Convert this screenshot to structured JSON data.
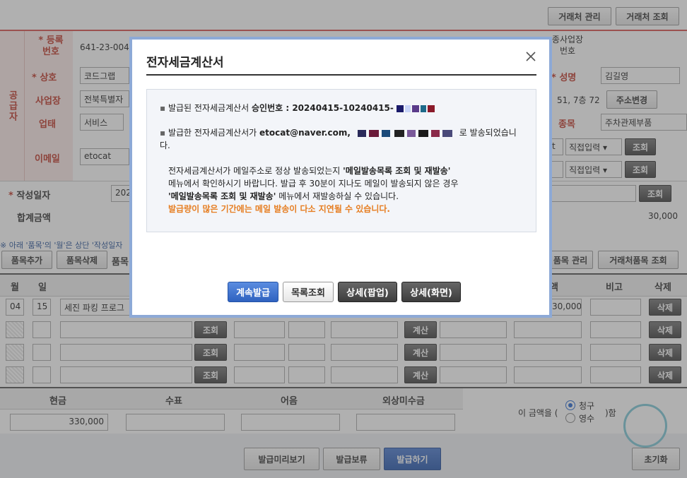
{
  "top_buttons": {
    "vendor_manage": "거래처 관리",
    "vendor_search": "거래처 조회"
  },
  "supplier": {
    "section_label": "공급자",
    "reg_no_label": "등록\n번호",
    "reg_no_value": "641-23-0042",
    "name_label": "상호",
    "name_value": "코드그랩",
    "biz_addr_label": "사업장",
    "biz_addr_value": "전북특별자",
    "biz_type_label": "업태",
    "biz_type_value": "서비스",
    "email_label": "이메일",
    "email_value": "etocat"
  },
  "buyer": {
    "sub_biz_label": "종사업장\n번호",
    "rep_name_label": "성명",
    "rep_name_value": "김길영",
    "addr_value": "51, 7층 72",
    "addr_change_button": "주소변경",
    "item_label": "종목",
    "item_value": "주차관제부품",
    "email_domain_1": "t",
    "email_select_1": "직접입력",
    "email_select_2": "직접입력",
    "lookup_button": "조회"
  },
  "write_date": {
    "label": "작성일자",
    "value": "202"
  },
  "total": {
    "label": "합계금액",
    "value": "30,000"
  },
  "notice": "※ 아래 '품목'의 '월'은 상단 '작성일자",
  "item_buttons": {
    "add": "품목추가",
    "delete": "품목삭제",
    "item_prefix": "품목",
    "item_manage": "품목 관리",
    "vendor_item_search": "거래처품목 조회"
  },
  "table_headers": {
    "month": "월",
    "day": "일",
    "amount_tail": "액",
    "remark": "비고",
    "delete": "삭제"
  },
  "rows": [
    {
      "month": "04",
      "day": "15",
      "item": "세진 파킹 프로그",
      "amount": "30,000"
    }
  ],
  "row_buttons": {
    "lookup": "조회",
    "calc": "계산",
    "delete": "삭제"
  },
  "payment": {
    "cash_label": "현금",
    "check_label": "수표",
    "note_label": "어음",
    "credit_label": "외상미수금",
    "cash_value": "330,000",
    "amount_text_prefix": "이 금액을 (",
    "amount_text_suffix": ")함",
    "opt_claim": "청구",
    "opt_receipt": "영수"
  },
  "bottom_buttons": {
    "preview": "발급미리보기",
    "hold": "발급보류",
    "issue": "발급하기",
    "reset": "초기화"
  },
  "modal": {
    "title": "전자세금계산서",
    "line1_prefix": "발급된 전자세금계산서 ",
    "line1_bold": "승인번호 : 20240415-10240415-",
    "line2_prefix": "발급한 전자세금계산서가 ",
    "line2_email": "etocat@naver.com,",
    "line2_suffix": "로 발송되었습니",
    "line2_tail": "다.",
    "p3_a": "전자세금계산서가 메일주소로 정상 발송되었는지 ",
    "p3_b": "'메일발송목록 조회 및 재발송'",
    "p3_c": "메뉴에서 확인하시기 바랍니다. 발급 후 30분이 지나도 메일이 발송되지 않은 경우",
    "p3_d": "'메일발송목록 조회 및 재발송'",
    "p3_e": " 메뉴에서 재발송하실 수 있습니다.",
    "warning": "발급량이 많은 기간에는 메일 발송이 다소 지연될 수 있습니다.",
    "btn_continue": "계속발급",
    "btn_list": "목록조회",
    "btn_popup": "상세(팝업)",
    "btn_screen": "상세(화면)"
  }
}
